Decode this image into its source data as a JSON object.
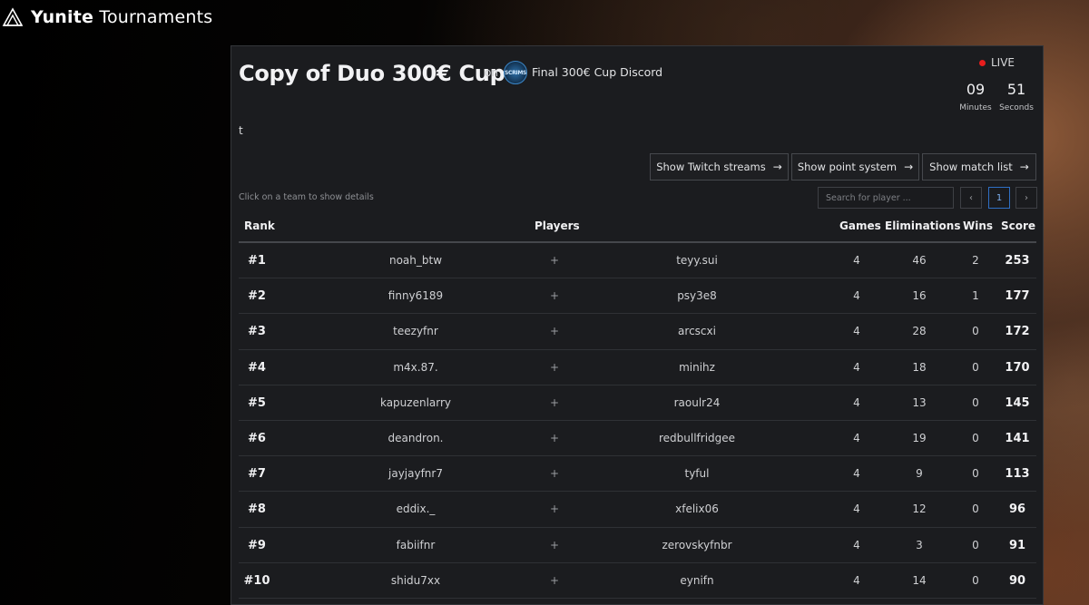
{
  "app": {
    "brand_bold": "Yunite",
    "brand_light": " Tournaments"
  },
  "tournament": {
    "title": "Copy of Duo 300€ Cup",
    "on_label": "on",
    "discord_logo_text": "SCRIMS",
    "discord_name": "Final 300€ Cup Discord",
    "description": "t",
    "live_label": "LIVE",
    "timer": {
      "minutes": "09",
      "minutes_label": "Minutes",
      "seconds": "51",
      "seconds_label": "Seconds"
    }
  },
  "actions": {
    "twitch": "Show Twitch streams",
    "points": "Show point system",
    "matches": "Show match list",
    "arrow_icon": "arrow-right-icon"
  },
  "list": {
    "hint": "Click on a team to show details",
    "search_placeholder": "Search for player ...",
    "page": "1",
    "prev": "‹",
    "next": "›"
  },
  "table": {
    "headers": {
      "rank": "Rank",
      "players": "Players",
      "games": "Games",
      "eliminations": "Eliminations",
      "wins": "Wins",
      "score": "Score"
    },
    "rows": [
      {
        "rank": "#1",
        "p1": "noah_btw",
        "plus": "+",
        "p2": "teyy.sui",
        "games": "4",
        "elims": "46",
        "wins": "2",
        "score": "253"
      },
      {
        "rank": "#2",
        "p1": "finny6189",
        "plus": "+",
        "p2": "psy3e8",
        "games": "4",
        "elims": "16",
        "wins": "1",
        "score": "177"
      },
      {
        "rank": "#3",
        "p1": "teezyfnr",
        "plus": "+",
        "p2": "arcscxi",
        "games": "4",
        "elims": "28",
        "wins": "0",
        "score": "172"
      },
      {
        "rank": "#4",
        "p1": "m4x.87.",
        "plus": "+",
        "p2": "minihz",
        "games": "4",
        "elims": "18",
        "wins": "0",
        "score": "170"
      },
      {
        "rank": "#5",
        "p1": "kapuzenlarry",
        "plus": "+",
        "p2": "raoulr24",
        "games": "4",
        "elims": "13",
        "wins": "0",
        "score": "145"
      },
      {
        "rank": "#6",
        "p1": "deandron.",
        "plus": "+",
        "p2": "redbullfridgee",
        "games": "4",
        "elims": "19",
        "wins": "0",
        "score": "141"
      },
      {
        "rank": "#7",
        "p1": "jayjayfnr7",
        "plus": "+",
        "p2": "tyful",
        "games": "4",
        "elims": "9",
        "wins": "0",
        "score": "113"
      },
      {
        "rank": "#8",
        "p1": "eddix._",
        "plus": "+",
        "p2": "xfelix06",
        "games": "4",
        "elims": "12",
        "wins": "0",
        "score": "96"
      },
      {
        "rank": "#9",
        "p1": "fabiifnr",
        "plus": "+",
        "p2": "zerovskyfnbr",
        "games": "4",
        "elims": "3",
        "wins": "0",
        "score": "91"
      },
      {
        "rank": "#10",
        "p1": "shidu7xx",
        "plus": "+",
        "p2": "eynifn",
        "games": "4",
        "elims": "14",
        "wins": "0",
        "score": "90"
      }
    ]
  }
}
